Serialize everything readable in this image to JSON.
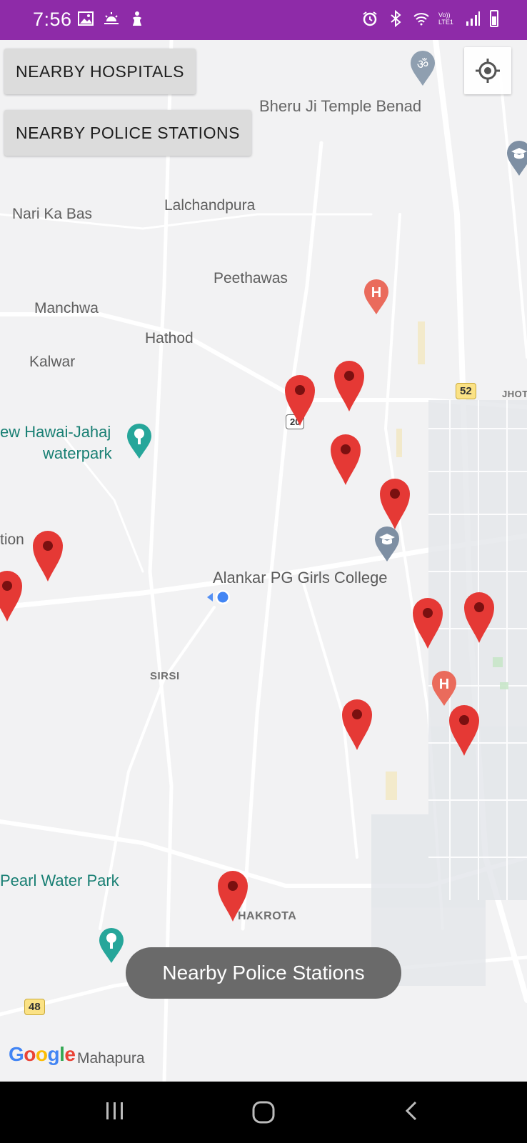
{
  "status_bar": {
    "time": "7:56",
    "background": "#8e2ba8",
    "left_icons": [
      "image-icon",
      "weather-icon",
      "accessibility-icon"
    ],
    "right_icons": [
      "alarm-icon",
      "bluetooth-icon",
      "wifi-icon",
      "volte-icon",
      "signal-icon",
      "battery-icon"
    ],
    "volte_label": "Vo)) LTE1"
  },
  "buttons": {
    "hospitals": "NEARBY HOSPITALS",
    "police": "NEARBY POLICE STATIONS"
  },
  "map": {
    "labels": {
      "temple": "Bheru Ji Temple Benad",
      "lalchandpura": "Lalchandpura",
      "nari_ka_bas": "Nari Ka Bas",
      "peethawas": "Peethawas",
      "manchwa": "Manchwa",
      "hathod": "Hathod",
      "kalwar": "Kalwar",
      "waterpark_line1": "ew Hawai-Jahaj",
      "waterpark_line2": "waterpark",
      "tion": "tion",
      "college": "Alankar PG Girls College",
      "sirsi": "SIRSI",
      "pearl": "Pearl Water Park",
      "jhot": "JHOT",
      "hakrota": "HAKROTA",
      "mahapura": "Mahapura"
    },
    "shields": {
      "route_52": "52",
      "route_48": "48",
      "route_20": "20"
    },
    "marker_color": "#e53935",
    "hospital_color": "#ea5e4e",
    "teal_poi_color": "#1a9c8f"
  },
  "toast": {
    "text": "Nearby Police Stations"
  },
  "attribution": {
    "google": [
      "G",
      "o",
      "o",
      "g",
      "l",
      "e"
    ]
  }
}
